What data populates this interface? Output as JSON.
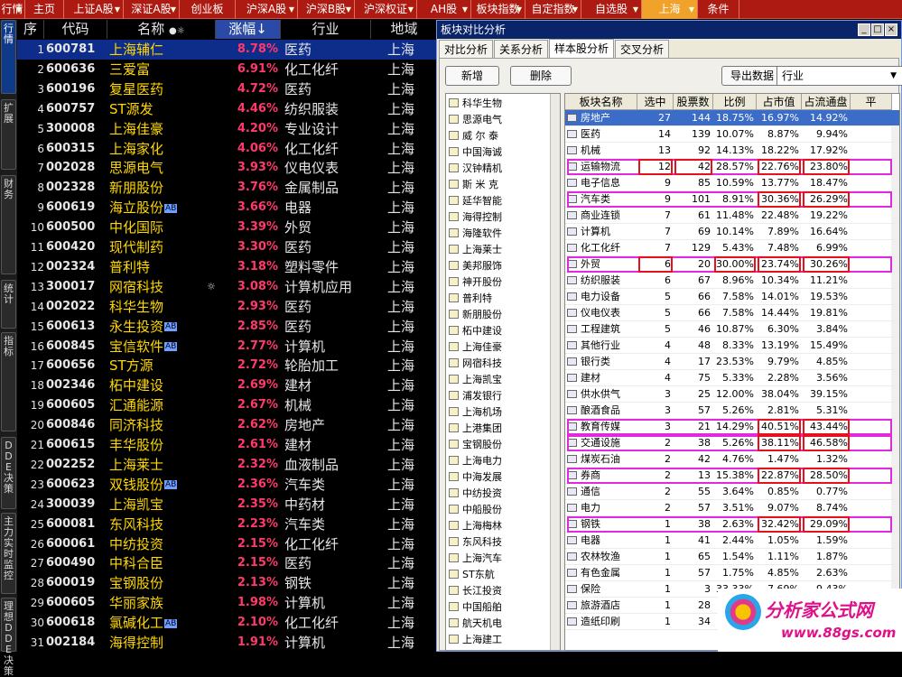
{
  "topbar": {
    "tabs": [
      {
        "label": "行情",
        "dropdown": true
      },
      {
        "label": "主页",
        "dropdown": false
      },
      {
        "label": "上证A股",
        "dropdown": true
      },
      {
        "label": "深证A股",
        "dropdown": true
      },
      {
        "label": "创业板",
        "dropdown": false
      },
      {
        "label": "沪深A股",
        "dropdown": true
      },
      {
        "label": "沪深B股",
        "dropdown": true
      },
      {
        "label": "沪深权证",
        "dropdown": true
      },
      {
        "label": "AH股",
        "dropdown": true
      },
      {
        "label": "板块指数",
        "dropdown": true
      },
      {
        "label": "自定指数",
        "dropdown": true
      },
      {
        "label": "自选股",
        "dropdown": true
      },
      {
        "label": "上海",
        "dropdown": true,
        "active": true
      },
      {
        "label": "条件",
        "dropdown": false
      }
    ]
  },
  "left_tabs": [
    "行情",
    "扩展",
    "财务",
    "统计",
    "指标",
    "DDE决策",
    "主力实时监控",
    "理想DDE决策"
  ],
  "grid": {
    "headers": {
      "no": "序号",
      "code": "代码",
      "name": "名称",
      "change": "涨幅↓",
      "industry": "行业",
      "region": "地域"
    },
    "rows": [
      {
        "no": "1",
        "code": "600781",
        "name": "上海辅仁",
        "change": "8.78%",
        "industry": "医药",
        "region": "上海"
      },
      {
        "no": "2",
        "code": "600636",
        "name": "三爱富",
        "change": "6.91%",
        "industry": "化工化纤",
        "region": "上海"
      },
      {
        "no": "3",
        "code": "600196",
        "name": "复星医药",
        "change": "4.72%",
        "industry": "医药",
        "region": "上海"
      },
      {
        "no": "4",
        "code": "600757",
        "name": "ST源发",
        "change": "4.46%",
        "industry": "纺织服装",
        "region": "上海"
      },
      {
        "no": "5",
        "code": "300008",
        "name": "上海佳豪",
        "change": "4.20%",
        "industry": "专业设计",
        "region": "上海"
      },
      {
        "no": "6",
        "code": "600315",
        "name": "上海家化",
        "change": "4.06%",
        "industry": "化工化纤",
        "region": "上海"
      },
      {
        "no": "7",
        "code": "002028",
        "name": "思源电气",
        "change": "3.93%",
        "industry": "仪电仪表",
        "region": "上海"
      },
      {
        "no": "8",
        "code": "002328",
        "name": "新朋股份",
        "change": "3.76%",
        "industry": "金属制品",
        "region": "上海"
      },
      {
        "no": "9",
        "code": "600619",
        "name": "海立股份",
        "change": "3.66%",
        "industry": "电器",
        "region": "上海",
        "ab": "AB"
      },
      {
        "no": "10",
        "code": "600500",
        "name": "中化国际",
        "change": "3.39%",
        "industry": "外贸",
        "region": "上海"
      },
      {
        "no": "11",
        "code": "600420",
        "name": "现代制药",
        "change": "3.30%",
        "industry": "医药",
        "region": "上海"
      },
      {
        "no": "12",
        "code": "002324",
        "name": "普利特",
        "change": "3.18%",
        "industry": "塑料零件",
        "region": "上海"
      },
      {
        "no": "13",
        "code": "300017",
        "name": "网宿科技",
        "change": "3.08%",
        "industry": "计算机应用",
        "region": "上海",
        "star": "☼"
      },
      {
        "no": "14",
        "code": "002022",
        "name": "科华生物",
        "change": "2.93%",
        "industry": "医药",
        "region": "上海"
      },
      {
        "no": "15",
        "code": "600613",
        "name": "永生投资",
        "change": "2.85%",
        "industry": "医药",
        "region": "上海",
        "ab": "AB"
      },
      {
        "no": "16",
        "code": "600845",
        "name": "宝信软件",
        "change": "2.77%",
        "industry": "计算机",
        "region": "上海",
        "ab": "AB"
      },
      {
        "no": "17",
        "code": "600656",
        "name": "ST方源",
        "change": "2.72%",
        "industry": "轮胎加工",
        "region": "上海"
      },
      {
        "no": "18",
        "code": "002346",
        "name": "柘中建设",
        "change": "2.69%",
        "industry": "建材",
        "region": "上海"
      },
      {
        "no": "19",
        "code": "600605",
        "name": "汇通能源",
        "change": "2.67%",
        "industry": "机械",
        "region": "上海"
      },
      {
        "no": "20",
        "code": "600846",
        "name": "同济科技",
        "change": "2.62%",
        "industry": "房地产",
        "region": "上海"
      },
      {
        "no": "21",
        "code": "600615",
        "name": "丰华股份",
        "change": "2.61%",
        "industry": "建材",
        "region": "上海"
      },
      {
        "no": "22",
        "code": "002252",
        "name": "上海莱士",
        "change": "2.32%",
        "industry": "血液制品",
        "region": "上海"
      },
      {
        "no": "23",
        "code": "600623",
        "name": "双钱股份",
        "change": "2.36%",
        "industry": "汽车类",
        "region": "上海",
        "ab": "AB"
      },
      {
        "no": "24",
        "code": "300039",
        "name": "上海凯宝",
        "change": "2.35%",
        "industry": "中药材",
        "region": "上海"
      },
      {
        "no": "25",
        "code": "600081",
        "name": "东风科技",
        "change": "2.23%",
        "industry": "汽车类",
        "region": "上海"
      },
      {
        "no": "26",
        "code": "600061",
        "name": "中纺投资",
        "change": "2.15%",
        "industry": "化工化纤",
        "region": "上海"
      },
      {
        "no": "27",
        "code": "600490",
        "name": "中科合臣",
        "change": "2.15%",
        "industry": "医药",
        "region": "上海"
      },
      {
        "no": "28",
        "code": "600019",
        "name": "宝钢股份",
        "change": "2.13%",
        "industry": "钢铁",
        "region": "上海"
      },
      {
        "no": "29",
        "code": "600605",
        "name": "华丽家族",
        "change": "1.98%",
        "industry": "计算机",
        "region": "上海"
      },
      {
        "no": "30",
        "code": "600618",
        "name": "氯碱化工",
        "change": "2.10%",
        "industry": "化工化纤",
        "region": "上海",
        "ab": "AB"
      },
      {
        "no": "31",
        "code": "002184",
        "name": "海得控制",
        "change": "1.91%",
        "industry": "计算机",
        "region": "上海"
      }
    ]
  },
  "window": {
    "title": "板块对比分析",
    "controls": [
      "_",
      "□",
      "×"
    ],
    "tabs": [
      "对比分析",
      "关系分析",
      "样本股分析",
      "交叉分析"
    ],
    "active_tab": "样本股分析",
    "buttons": {
      "add": "新增",
      "delete": "删除",
      "export": "导出数据"
    },
    "select_value": "行业",
    "stock_list": [
      "科华生物",
      "思源电气",
      "威 尔 泰",
      "中国海诚",
      "汉钟精机",
      "斯 米 克",
      "延华智能",
      "海得控制",
      "海隆软件",
      "上海莱士",
      "美邦服饰",
      "神开股份",
      "普利特",
      "新朋股份",
      "柘中建设",
      "上海佳豪",
      "网宿科技",
      "上海凯宝",
      "浦发银行",
      "上海机场",
      "上港集团",
      "宝钢股份",
      "上海电力",
      "中海发展",
      "中纺投资",
      "中船股份",
      "上海梅林",
      "东风科技",
      "上海汽车",
      "ST东航",
      "长江投资",
      "中国船舶",
      "航天机电",
      "上海建工"
    ],
    "table": {
      "headers": [
        "板块名称",
        "选中",
        "股票数",
        "比例",
        "占市值",
        "占流通盘",
        "平"
      ],
      "rows": [
        [
          "房地产",
          "27",
          "144",
          "18.75%",
          "16.97%",
          "14.92%"
        ],
        [
          "医药",
          "14",
          "139",
          "10.07%",
          "8.87%",
          "9.94%"
        ],
        [
          "机械",
          "13",
          "92",
          "14.13%",
          "18.22%",
          "17.92%"
        ],
        [
          "运输物流",
          "12",
          "42",
          "28.57%",
          "22.76%",
          "23.80%"
        ],
        [
          "电子信息",
          "9",
          "85",
          "10.59%",
          "13.77%",
          "18.47%"
        ],
        [
          "汽车类",
          "9",
          "101",
          "8.91%",
          "30.36%",
          "26.29%"
        ],
        [
          "商业连锁",
          "7",
          "61",
          "11.48%",
          "22.48%",
          "19.22%"
        ],
        [
          "计算机",
          "7",
          "69",
          "10.14%",
          "7.89%",
          "16.64%"
        ],
        [
          "化工化纤",
          "7",
          "129",
          "5.43%",
          "7.48%",
          "6.99%"
        ],
        [
          "外贸",
          "6",
          "20",
          "30.00%",
          "23.74%",
          "30.26%"
        ],
        [
          "纺织服装",
          "6",
          "67",
          "8.96%",
          "10.34%",
          "11.21%"
        ],
        [
          "电力设备",
          "5",
          "66",
          "7.58%",
          "14.01%",
          "19.53%"
        ],
        [
          "仪电仪表",
          "5",
          "66",
          "7.58%",
          "14.44%",
          "19.81%"
        ],
        [
          "工程建筑",
          "5",
          "46",
          "10.87%",
          "6.30%",
          "3.84%"
        ],
        [
          "其他行业",
          "4",
          "48",
          "8.33%",
          "13.19%",
          "15.49%"
        ],
        [
          "银行类",
          "4",
          "17",
          "23.53%",
          "9.79%",
          "4.85%"
        ],
        [
          "建材",
          "4",
          "75",
          "5.33%",
          "2.28%",
          "3.56%"
        ],
        [
          "供水供气",
          "3",
          "25",
          "12.00%",
          "38.04%",
          "39.15%"
        ],
        [
          "酿酒食品",
          "3",
          "57",
          "5.26%",
          "2.81%",
          "5.31%"
        ],
        [
          "教育传媒",
          "3",
          "21",
          "14.29%",
          "40.51%",
          "43.44%"
        ],
        [
          "交通设施",
          "2",
          "38",
          "5.26%",
          "38.11%",
          "46.58%"
        ],
        [
          "煤炭石油",
          "2",
          "42",
          "4.76%",
          "1.47%",
          "1.32%"
        ],
        [
          "券商",
          "2",
          "13",
          "15.38%",
          "22.87%",
          "28.50%"
        ],
        [
          "通信",
          "2",
          "55",
          "3.64%",
          "0.85%",
          "0.77%"
        ],
        [
          "电力",
          "2",
          "57",
          "3.51%",
          "9.07%",
          "8.74%"
        ],
        [
          "钢铁",
          "1",
          "38",
          "2.63%",
          "32.42%",
          "29.09%"
        ],
        [
          "电器",
          "1",
          "41",
          "2.44%",
          "1.05%",
          "1.59%"
        ],
        [
          "农林牧渔",
          "1",
          "65",
          "1.54%",
          "1.11%",
          "1.87%"
        ],
        [
          "有色金属",
          "1",
          "57",
          "1.75%",
          "4.85%",
          "2.63%"
        ],
        [
          "保险",
          "1",
          "3",
          "33.33%",
          "7.69%",
          "9.43%"
        ],
        [
          "旅游酒店",
          "1",
          "28",
          "3.57%",
          "14.39%",
          "7.40%"
        ],
        [
          "造纸印刷",
          "1",
          "34",
          "2.94%",
          "",
          "0.71%"
        ]
      ],
      "selected_row": 0
    }
  },
  "watermark": {
    "line1": "分析家公式网",
    "line2": "www.88gs.com"
  },
  "colors": {
    "topbar": "#ad1a12",
    "active_tab": "#f0a22a",
    "name_text": "#ffd800",
    "change_text": "#ff3a6a",
    "highlight_red": "#e8101e",
    "highlight_magenta": "#e02bdc",
    "selection": "#3a6cc8"
  }
}
